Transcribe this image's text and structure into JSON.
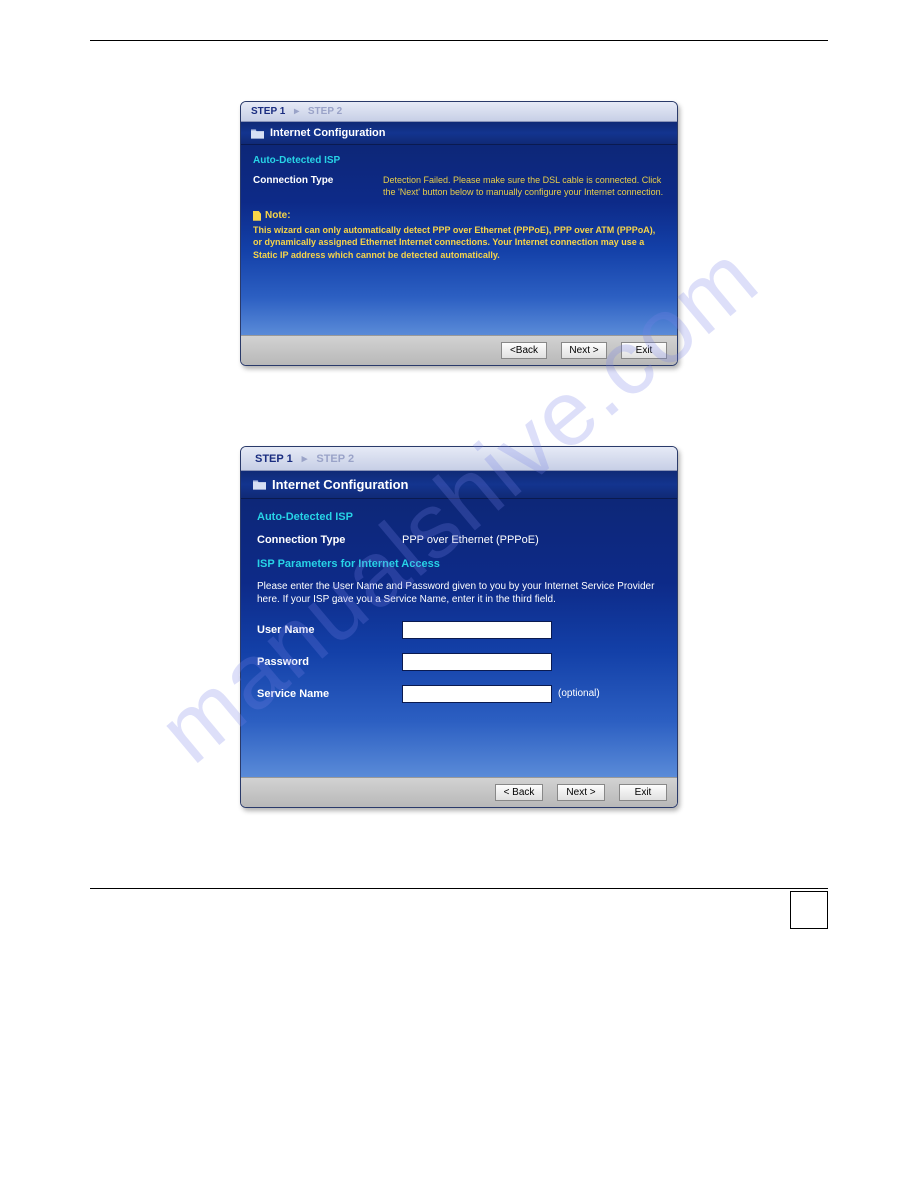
{
  "watermark": "manualshive.com",
  "wizard1": {
    "steps": {
      "active": "STEP 1",
      "inactive": "STEP 2"
    },
    "title": "Internet Configuration",
    "section_head": "Auto-Detected ISP",
    "conn_type_label": "Connection Type",
    "conn_type_value": "Detection Failed. Please make sure the DSL cable is connected. Click the 'Next' button below to manually configure your Internet connection.",
    "note_label": "Note:",
    "note_body": "This wizard can only automatically detect PPP over Ethernet (PPPoE), PPP over ATM (PPPoA), or dynamically assigned Ethernet Internet connections. Your Internet connection may use a Static IP address which cannot be detected automatically.",
    "buttons": {
      "back": "<Back",
      "next": "Next >",
      "exit": "Exit"
    }
  },
  "wizard2": {
    "steps": {
      "active": "STEP 1",
      "inactive": "STEP 2"
    },
    "title": "Internet Configuration",
    "section_head": "Auto-Detected ISP",
    "conn_type_label": "Connection Type",
    "conn_type_value": "PPP over Ethernet (PPPoE)",
    "isp_head": "ISP Parameters for Internet Access",
    "isp_desc": "Please enter the User Name and Password given to you by your Internet Service Provider here. If your ISP gave you a Service Name, enter it in the third field.",
    "fields": {
      "user_label": "User Name",
      "user_value": "",
      "pass_label": "Password",
      "pass_value": "",
      "service_label": "Service Name",
      "service_value": "",
      "service_suffix": "(optional)"
    },
    "buttons": {
      "back": "< Back",
      "next": "Next >",
      "exit": "Exit"
    }
  }
}
